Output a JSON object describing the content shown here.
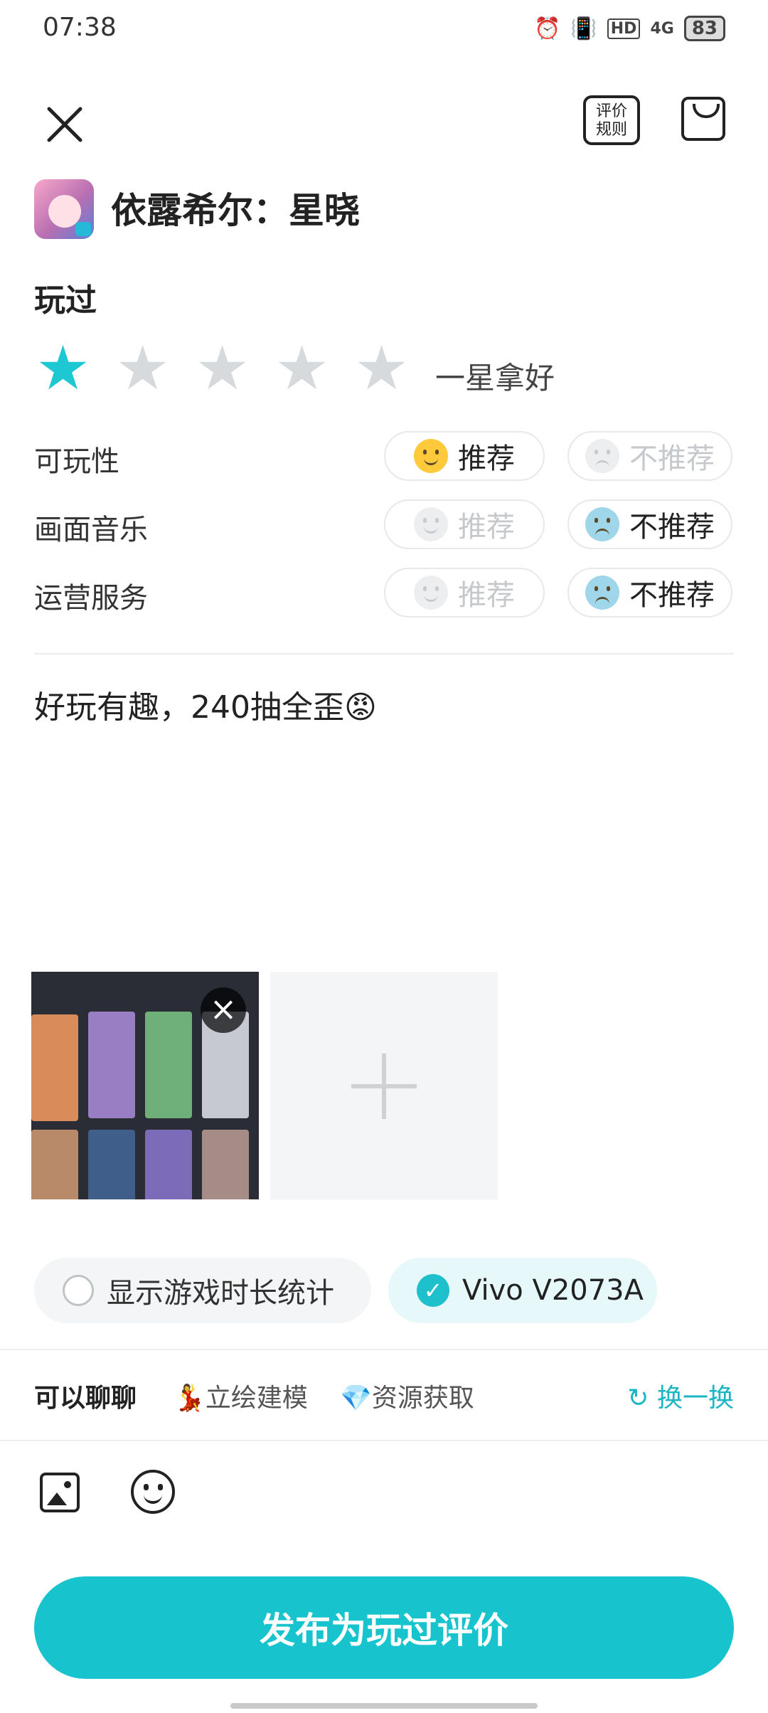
{
  "status_bar": {
    "time": "07:38",
    "battery": "83",
    "network": "4G",
    "hd": "HD"
  },
  "header": {
    "rule_button": "评价\n规则"
  },
  "game": {
    "title": "依露希尔：星晓"
  },
  "rating": {
    "section_label": "玩过",
    "stars_selected": 1,
    "stars_total": 5,
    "caption": "一星拿好"
  },
  "aspects": [
    {
      "label": "可玩性",
      "recommend": "推荐",
      "not_recommend": "不推荐",
      "choice": "recommend"
    },
    {
      "label": "画面音乐",
      "recommend": "推荐",
      "not_recommend": "不推荐",
      "choice": "not_recommend"
    },
    {
      "label": "运营服务",
      "recommend": "推荐",
      "not_recommend": "不推荐",
      "choice": "not_recommend"
    }
  ],
  "review": {
    "text": "好玩有趣，240抽全歪😡"
  },
  "options": {
    "show_playtime": "显示游戏时长统计",
    "device": "Vivo V2073A"
  },
  "topics": {
    "lead": "可以聊聊",
    "items": [
      "💃立绘建模",
      "💎资源获取"
    ],
    "swap": "换一换"
  },
  "publish": {
    "label": "发布为玩过评价"
  },
  "colors": {
    "accent": "#17c4cd",
    "star_off": "#d7dadc"
  }
}
